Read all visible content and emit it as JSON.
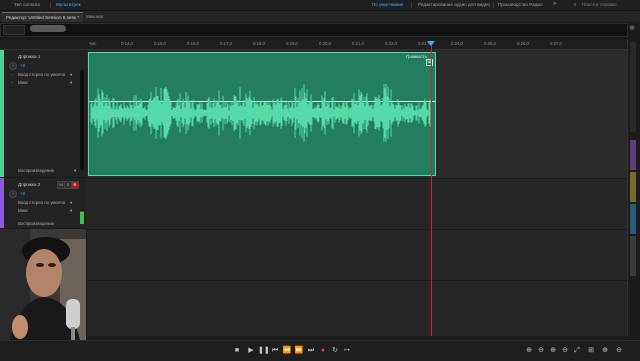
{
  "topbar": {
    "items": [
      "Тип сигнала",
      "Мультитрек",
      "По умолчанию",
      "Редактирование аудио для видео",
      "Производство Радио"
    ],
    "active_index": 1,
    "search_icon": "search-icon"
  },
  "tabs": {
    "editor": "Редактор: Untitled Session 6.sesx *",
    "mixer": "Микшер"
  },
  "ruler": {
    "start_label": "чмс",
    "ticks": [
      "0:14,0",
      "0:15,0",
      "0:16,0",
      "0:17,0",
      "0:18,0",
      "0:19,0",
      "0:20,0",
      "0:21,0",
      "0:22,0",
      "0:23,0",
      "0:24,0",
      "0:25,0",
      "0:26,0",
      "0:27,0"
    ]
  },
  "tracks": [
    {
      "name": "Дорожка 1",
      "volume": "+0",
      "input": "Вход стерео по умолча",
      "output": "Микс",
      "mode": "Воспроизведение",
      "stripe_color": "#4fcf9c"
    },
    {
      "name": "Дорожка 2",
      "volume": "+0",
      "input": "Вход стерео по умолча",
      "output": "Микс",
      "mode": "Воспроизведение",
      "stripe_color": "#8a5bd6"
    }
  ],
  "clip": {
    "label": "Громкость"
  },
  "colors": {
    "clip_bg": "#237d5f",
    "waveform": "#57d9a9",
    "playhead": "#c62828",
    "accent": "#4aa3ff"
  }
}
